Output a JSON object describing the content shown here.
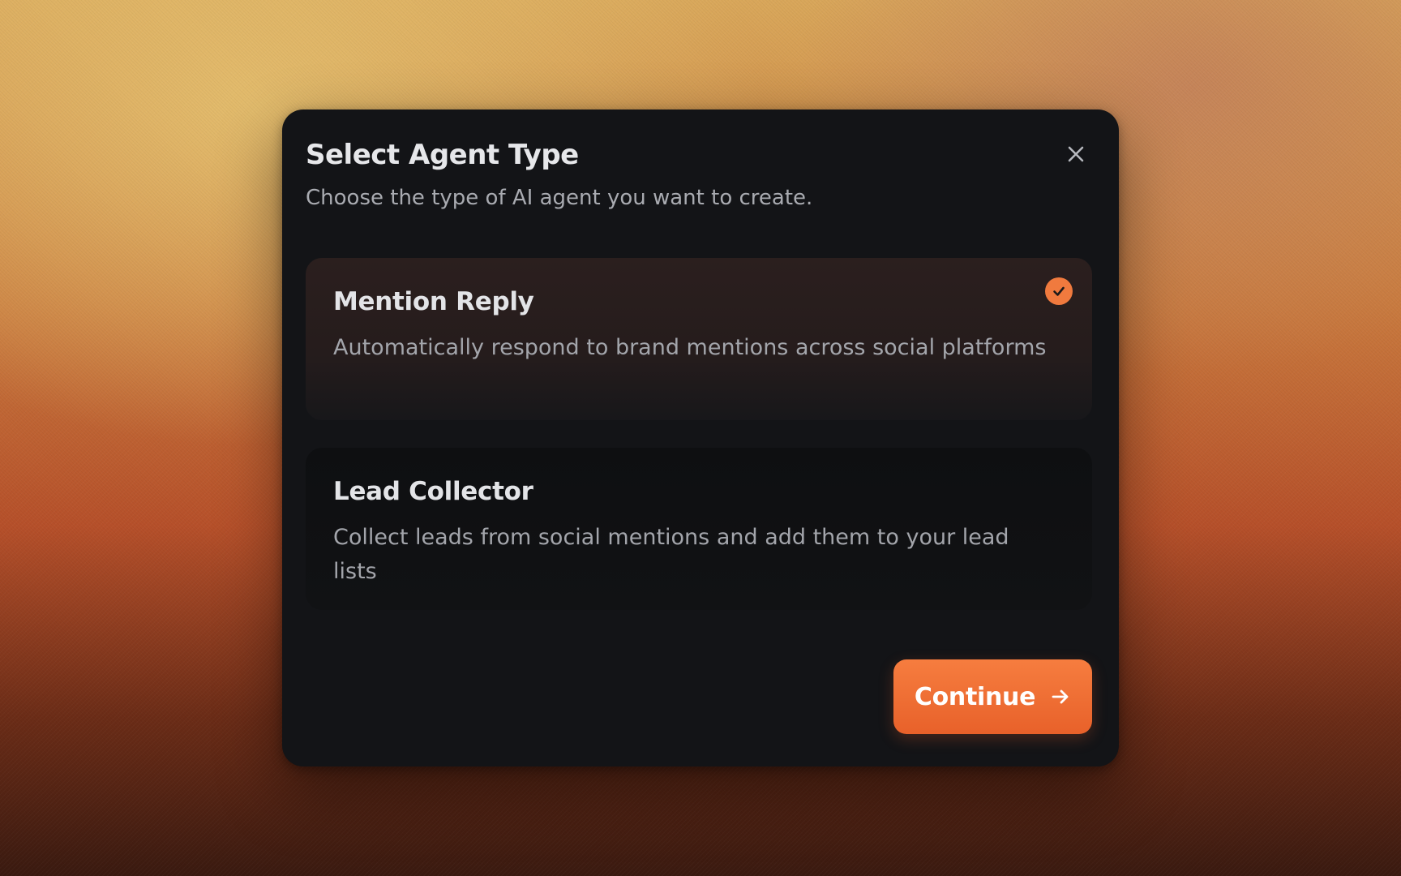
{
  "dialog": {
    "title": "Select Agent Type",
    "subtitle": "Choose the type of AI agent you want to create.",
    "close_icon": "close-icon"
  },
  "options": [
    {
      "title": "Mention Reply",
      "description": "Automatically respond to brand mentions across social platforms",
      "selected": true
    },
    {
      "title": "Lead Collector",
      "description": "Collect leads from social mentions and add them to your lead lists",
      "selected": false
    }
  ],
  "actions": {
    "continue_label": "Continue",
    "continue_icon": "arrow-right-icon"
  },
  "colors": {
    "accent": "#f07a3e",
    "dialog_bg": "#131417",
    "selected_card_bg": "#2b1f1e"
  }
}
